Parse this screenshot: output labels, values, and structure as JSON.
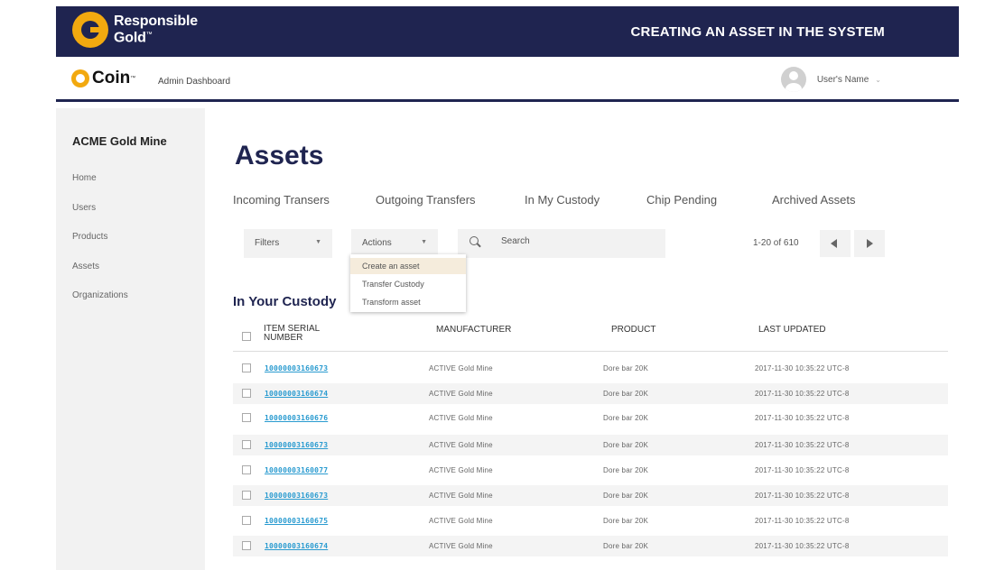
{
  "banner": {
    "brand_line1": "Responsible",
    "brand_line2": "Gold",
    "trademark": "™",
    "title": "CREATING AN ASSET IN THE SYSTEM"
  },
  "appbar": {
    "logo_text": "Coin",
    "trademark": "™",
    "subtitle": "Admin Dashboard",
    "user_name": "User's Name",
    "user_caret": "⌄"
  },
  "sidebar": {
    "org_name": "ACME Gold Mine",
    "items": [
      "Home",
      "Users",
      "Products",
      "Assets",
      "Organizations"
    ]
  },
  "main": {
    "title": "Assets",
    "tabs": [
      "Incoming Transers",
      "Outgoing Transfers",
      "In My Custody",
      "Chip Pending",
      "Archived Assets"
    ],
    "filters_label": "Filters",
    "actions_label": "Actions",
    "search_placeholder": "Search",
    "pager_text": "1-20 of 610",
    "dropdown_items": [
      "Create an asset",
      "Transfer Custody",
      "Transform asset"
    ],
    "section_title": "In Your Custody"
  },
  "table": {
    "headers": {
      "serial_line1": "ITEM SERIAL",
      "serial_line2": "NUMBER",
      "manufacturer": "MANUFACTURER",
      "product": "PRODUCT",
      "last_updated": "LAST UPDATED"
    },
    "rows": [
      {
        "serial": "10000003160673",
        "manufacturer": "ACTIVE Gold Mine",
        "product": "Dore bar 20K",
        "updated": "2017-11-30  10:35:22  UTC-8"
      },
      {
        "serial": "10000003160674",
        "manufacturer": "ACTIVE Gold Mine",
        "product": "Dore bar 20K",
        "updated": "2017-11-30  10:35:22  UTC-8"
      },
      {
        "serial": "10000003160676",
        "manufacturer": "ACTIVE Gold Mine",
        "product": "Dore bar 20K",
        "updated": "2017-11-30  10:35:22  UTC-8"
      },
      {
        "serial": "10000003160673",
        "manufacturer": "ACTIVE Gold Mine",
        "product": "Dore bar 20K",
        "updated": "2017-11-30  10:35:22  UTC-8"
      },
      {
        "serial": "10000003160077",
        "manufacturer": "ACTIVE Gold Mine",
        "product": "Dore bar 20K",
        "updated": "2017-11-30  10:35:22  UTC-8"
      },
      {
        "serial": "10000003160673",
        "manufacturer": "ACTIVE Gold Mine",
        "product": "Dore bar 20K",
        "updated": "2017-11-30  10:35:22  UTC-8"
      },
      {
        "serial": "10000003160675",
        "manufacturer": "ACTIVE Gold Mine",
        "product": "Dore bar 20K",
        "updated": "2017-11-30  10:35:22  UTC-8"
      },
      {
        "serial": "10000003160674",
        "manufacturer": "ACTIVE Gold Mine",
        "product": "Dore bar 20K",
        "updated": "2017-11-30  10:35:22  UTC-8"
      }
    ]
  },
  "colors": {
    "navy": "#1f2450",
    "gold": "#f2a90f",
    "link": "#2a9bd0"
  }
}
